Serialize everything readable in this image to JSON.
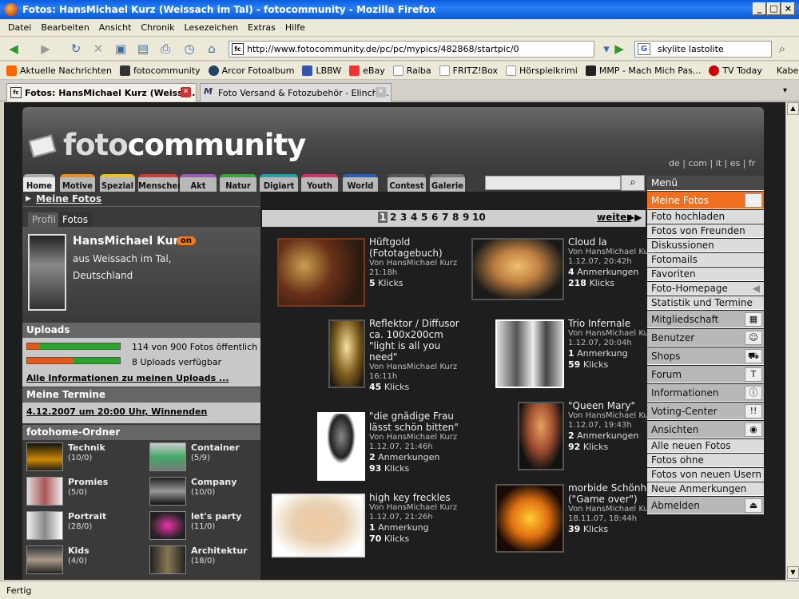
{
  "window": {
    "title": "Fotos: HansMichael Kurz (Weissach im Tal) - fotocommunity - Mozilla Firefox"
  },
  "menu": [
    "Datei",
    "Bearbeiten",
    "Ansicht",
    "Chronik",
    "Lesezeichen",
    "Extras",
    "Hilfe"
  ],
  "url": "http://www.fotocommunity.de/pc/pc/mypics/482868/startpic/0",
  "search_value": "skylite lastolite",
  "bookmarks": [
    "Aktuelle Nachrichten",
    "fotocommunity",
    "Arcor Fotoalbum",
    "LBBW",
    "eBay",
    "Raiba",
    "FRITZ!Box",
    "Hörspielkrimi",
    "MMP - Mach Mich Pas...",
    "TV Today",
    "Kabel BW"
  ],
  "tabs": [
    "Fotos: HansMichael Kurz (Weissa...",
    "Foto Versand & Fotozubehör - Elinchr..."
  ],
  "status": "Fertig",
  "site": {
    "logo_a": "foto",
    "logo_b": "community",
    "langs": "de | com | it | es | fr",
    "nav": [
      "Home",
      "Motive",
      "Spezial",
      "Menschen",
      "Akt",
      "Natur",
      "Digiart",
      "Youth",
      "World",
      "Contest",
      "Galerie"
    ]
  },
  "left": {
    "meine_fotos": "Meine Fotos",
    "tab_profil": "Profil",
    "tab_fotos": "Fotos",
    "name": "HansMichael Kurz",
    "online": "on",
    "loc1": "aus Weissach im Tal,",
    "loc2": "Deutschland",
    "uploads_head": "Uploads",
    "upload_line1": "114 von 900 Fotos öffentlich",
    "upload_line2": "8 Uploads verfügbar",
    "upload_fraction1": 0.127,
    "upload_fraction2": 0.5,
    "upload_link": "Alle Informationen zu meinen Uploads ...",
    "termine_head": "Meine Termine",
    "termin": "4.12.2007 um 20:00 Uhr, Winnenden",
    "folder_head": "fotohome-Ordner",
    "folders": [
      {
        "name": "Technik",
        "count": "(10/0)"
      },
      {
        "name": "Container",
        "count": "(5/9)"
      },
      {
        "name": "Promies",
        "count": "(5/0)"
      },
      {
        "name": "Company",
        "count": "(10/0)"
      },
      {
        "name": "Portrait",
        "count": "(28/0)"
      },
      {
        "name": "let's party",
        "count": "(11/0)"
      },
      {
        "name": "Kids",
        "count": "(4/0)"
      },
      {
        "name": "Architektur",
        "count": "(18/0)"
      }
    ]
  },
  "pager": {
    "pages": [
      "1",
      "2",
      "3",
      "4",
      "5",
      "6",
      "7",
      "8",
      "9",
      "10"
    ],
    "next": "weiter"
  },
  "photos": [
    {
      "title": "Hüftgold (Fototagebuch)",
      "by": "Von HansMichael Kurz",
      "date": "21:18h",
      "notes": "",
      "clicks_n": "5",
      "clicks": "Klicks"
    },
    {
      "title": "Cloud la",
      "by": "Von HansMichael Kurz",
      "date": "1.12.07, 20:42h",
      "notes_n": "4",
      "notes": "Anmerkungen",
      "clicks_n": "218",
      "clicks": "Klicks"
    },
    {
      "title": "Reflektor / Diffusor ca. 100x200cm \"light is all you need\"",
      "by": "Von HansMichael Kurz",
      "date": "16:11h",
      "notes": "",
      "clicks_n": "45",
      "clicks": "Klicks"
    },
    {
      "title": "Trio Infernale",
      "by": "Von HansMichael Kurz",
      "date": "1.12.07, 20:04h",
      "notes_n": "1",
      "notes": "Anmerkung",
      "clicks_n": "59",
      "clicks": "Klicks"
    },
    {
      "title": "\"die gnädige Frau lässt schön bitten\"",
      "by": "Von HansMichael Kurz",
      "date": "1.12.07, 21:46h",
      "notes_n": "2",
      "notes": "Anmerkungen",
      "clicks_n": "93",
      "clicks": "Klicks"
    },
    {
      "title": "\"Queen Mary\"",
      "by": "Von HansMichael Kurz",
      "date": "1.12.07, 19:43h",
      "notes_n": "2",
      "notes": "Anmerkungen",
      "clicks_n": "92",
      "clicks": "Klicks"
    },
    {
      "title": "high key freckles",
      "by": "Von HansMichael Kurz",
      "date": "1.12.07, 21:26h",
      "notes_n": "1",
      "notes": "Anmerkung",
      "clicks_n": "70",
      "clicks": "Klicks"
    },
    {
      "title": "morbide Schönheit (\"Game over\")",
      "by": "Von HansMichael Kurz",
      "date": "18.11.07, 18:44h",
      "notes": "",
      "clicks_n": "39",
      "clicks": "Klicks"
    }
  ],
  "rightmenu": {
    "head": "Menü",
    "items": [
      "Meine Fotos",
      "Foto hochladen",
      "Fotos von Freunden",
      "Diskussionen",
      "Fotomails",
      "Favoriten",
      "Foto-Homepage",
      "Statistik und Termine",
      "Mitgliedschaft",
      "Benutzer",
      "Shops",
      "Forum",
      "Informationen",
      "Voting-Center",
      "Ansichten",
      "Alle neuen Fotos",
      "Fotos ohne Anmerkungen",
      "Fotos von neuen Usern",
      "Neue Anmerkungen",
      "Abmelden"
    ]
  }
}
